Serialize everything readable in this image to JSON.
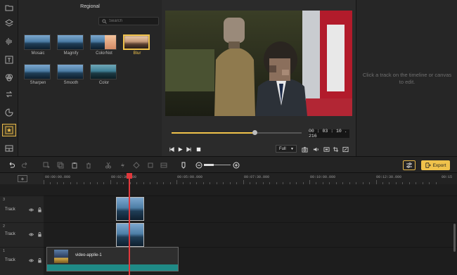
{
  "panel": {
    "title": "Regional",
    "search_placeholder": "Search",
    "effects": [
      {
        "label": "Mosaic",
        "selected": false
      },
      {
        "label": "Magnify",
        "selected": false
      },
      {
        "label": "ColorNot",
        "selected": false
      },
      {
        "label": "Blur",
        "selected": true
      },
      {
        "label": "Sharpen",
        "selected": false
      },
      {
        "label": "Smooth",
        "selected": false
      },
      {
        "label": "Color",
        "selected": false
      }
    ]
  },
  "rail": {
    "icons": [
      "folder-icon",
      "layers-icon",
      "audio-wave-icon",
      "text-icon",
      "filter-icon",
      "transition-icon",
      "sticker-icon",
      "effects-icon",
      "layout-icon"
    ],
    "active_index": 7
  },
  "preview": {
    "timecode": "00 : 03 : 10 . 216",
    "progress": 0.64,
    "zoom": "Full"
  },
  "properties": {
    "message": "Click a track on the timeline or canvas to edit."
  },
  "toolbar": {
    "export_label": "Export"
  },
  "timeline": {
    "ruler_labels": [
      "00:00:00.000",
      "00:02:30.000",
      "00:05:00.000",
      "00:07:30.000",
      "00:10:00.000",
      "00:12:30.000",
      "00:15"
    ],
    "tracks": [
      {
        "number": "3",
        "name": "Track"
      },
      {
        "number": "2",
        "name": "Track"
      },
      {
        "number": "1",
        "name": "Track"
      }
    ],
    "video_clip_name": "video-applie-1"
  },
  "colors": {
    "accent": "#f0c24b",
    "playhead": "#e0383c",
    "audio_wave": "#1f8a86"
  }
}
